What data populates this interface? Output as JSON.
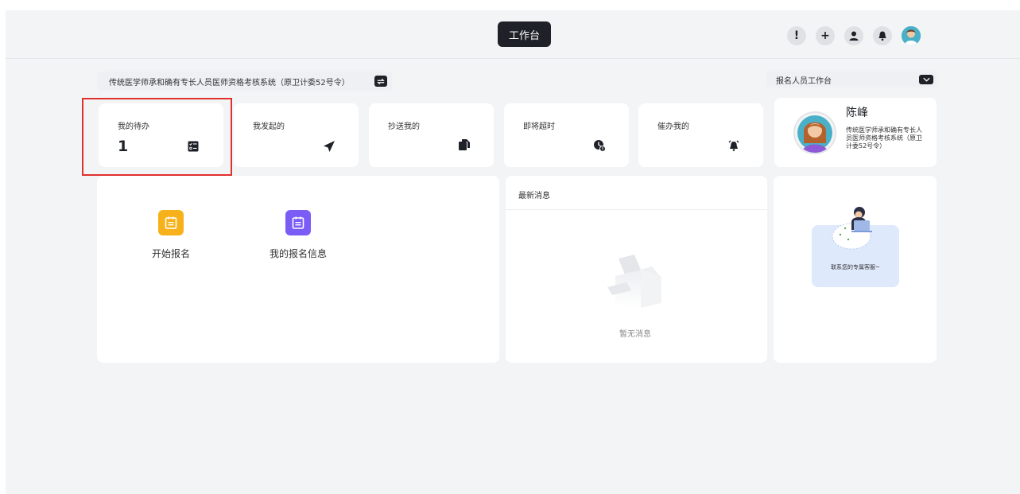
{
  "header": {
    "title": "工作台",
    "icons": [
      "alert-icon",
      "plus-icon",
      "user-icon",
      "bell-icon",
      "avatar"
    ]
  },
  "system_selector": {
    "label": "传统医学师承和确有专长人员医师资格考核系统（原卫计委52号令）",
    "switch_icon": "swap-icon"
  },
  "role_select": {
    "value": "报名人员工作台",
    "arrow_icon": "chevron-down-icon"
  },
  "stats": [
    {
      "label": "我的待办",
      "value": "1",
      "icon": "checklist-icon"
    },
    {
      "label": "我发起的",
      "value": "",
      "icon": "send-icon"
    },
    {
      "label": "抄送我的",
      "value": "",
      "icon": "copy-icon"
    },
    {
      "label": "即将超时",
      "value": "",
      "icon": "clock-alert-icon"
    },
    {
      "label": "催办我的",
      "value": "",
      "icon": "alarm-icon"
    }
  ],
  "profile": {
    "name": "陈峰",
    "desc": "传统医学师承和确有专长人员医师资格考核系统（原卫计委52号令）"
  },
  "apps": [
    {
      "label": "开始报名",
      "icon": "form-icon",
      "color": "#f7b21b"
    },
    {
      "label": "我的报名信息",
      "icon": "form-icon",
      "color": "#7b5cf5"
    }
  ],
  "messages": {
    "title": "最新消息",
    "empty_text": "暂无消息"
  },
  "support": {
    "text": "联系您的专属客服~"
  },
  "colors": {
    "accent_dark": "#1e2128",
    "highlight_border": "#e0302d",
    "background": "#f3f4f6"
  }
}
